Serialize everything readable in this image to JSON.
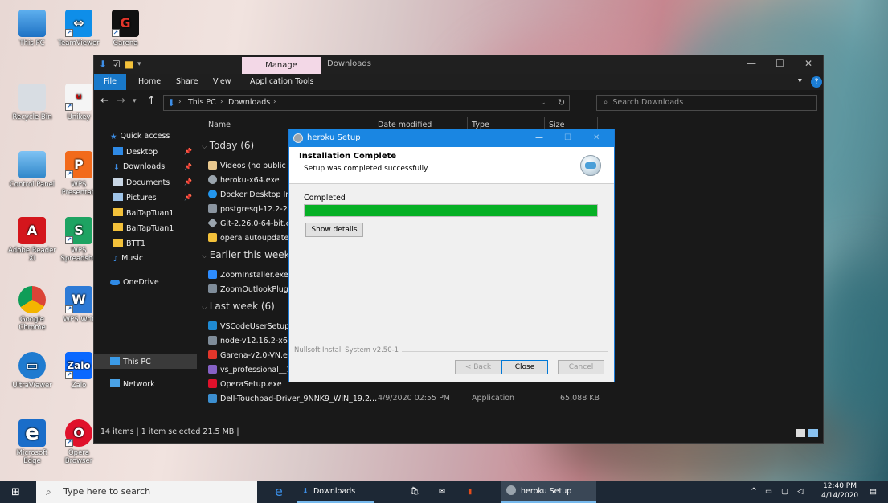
{
  "desktop": {
    "icons": [
      "This PC",
      "TeamViewer",
      "Garena",
      "Recycle Bin",
      "Unikey",
      "Control Panel",
      "WPS Presentati",
      "Adobe Reader XI",
      "WPS Spreadshe",
      "Google Chrome",
      "WPS Writ",
      "UltraViewer",
      "Zalo",
      "Microsoft Edge",
      "Opera Browser"
    ]
  },
  "explorer": {
    "manage_tab": "Manage",
    "title": "Downloads",
    "ribbon_tabs": [
      "File",
      "Home",
      "Share",
      "View",
      "Application Tools"
    ],
    "breadcrumb": [
      "This PC",
      "Downloads"
    ],
    "search_placeholder": "Search Downloads",
    "nav": {
      "quick_access": "Quick access",
      "items": [
        "Desktop",
        "Downloads",
        "Documents",
        "Pictures",
        "BaiTapTuan1",
        "BaiTapTuan1",
        "BTT1",
        "Music"
      ],
      "onedrive": "OneDrive",
      "thispc": "This PC",
      "network": "Network"
    },
    "columns": [
      "Name",
      "Date modified",
      "Type",
      "Size"
    ],
    "groups": {
      "today": "Today (6)",
      "earlier": "Earlier this week (2",
      "last": "Last week (6)"
    },
    "files": {
      "today": [
        "Videos (no public to",
        "heroku-x64.exe",
        "Docker Desktop Inst",
        "postgresql-12.2-2-w",
        "Git-2.26.0-64-bit.exe",
        "opera autoupdate"
      ],
      "earlier": [
        "ZoomInstaller.exe",
        "ZoomOutlookPlugi"
      ],
      "last": [
        "VSCodeUserSetup-x",
        "node-v12.16.2-x64.r",
        "Garena-v2.0-VN.exe",
        "vs_professional__10",
        "OperaSetup.exe",
        "Dell-Touchpad-Driver_9NNK9_WIN_19.2..."
      ]
    },
    "last_row": {
      "date": "4/9/2020 02:55 PM",
      "type": "Application",
      "size": "65,088 KB"
    },
    "status": "14 items  |  1 item selected  21.5 MB  |"
  },
  "dialog": {
    "title": "heroku Setup",
    "head_title": "Installation Complete",
    "head_sub": "Setup was completed successfully.",
    "completed_label": "Completed",
    "progress": 1.0,
    "show_details": "Show details",
    "nsis": "Nullsoft Install System v2.50-1",
    "back": "< Back",
    "close": "Close",
    "cancel": "Cancel"
  },
  "taskbar": {
    "search_placeholder": "Type here to search",
    "downloads": "Downloads",
    "heroku": "heroku Setup",
    "time": "12:40 PM",
    "date": "4/14/2020"
  },
  "colors": {
    "accent": "#1a86e2",
    "progress": "#06b025",
    "manage_tab": "#f3d8e7"
  }
}
